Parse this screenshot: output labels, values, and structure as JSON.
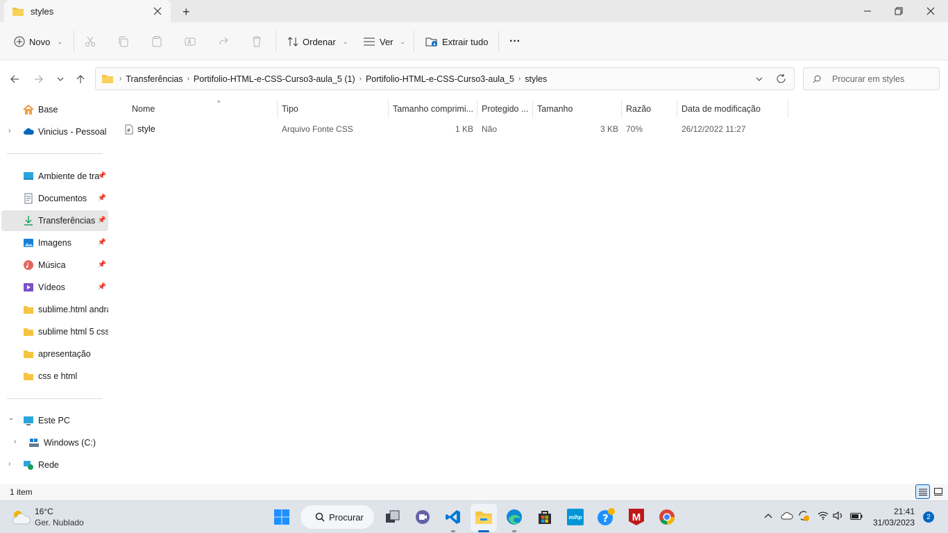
{
  "window": {
    "tab_title": "styles",
    "new_tab_symbol": "+",
    "controls": {
      "minimize_icon": "minimize-icon",
      "maximize_icon": "restore-icon",
      "close_icon": "close-icon"
    }
  },
  "commandbar": {
    "new_label": "Novo",
    "sort_label": "Ordenar",
    "view_label": "Ver",
    "extract_label": "Extrair tudo",
    "more_label": "···"
  },
  "address": {
    "breadcrumbs": [
      "Transferências",
      "Portifolio-HTML-e-CSS-Curso3-aula_5 (1)",
      "Portifolio-HTML-e-CSS-Curso3-aula_5",
      "styles"
    ],
    "separator": "›",
    "search_placeholder": "Procurar em styles"
  },
  "sidebar": {
    "top": [
      {
        "label": "Base",
        "icon": "home-icon"
      },
      {
        "label": "Vinicius - Pessoal",
        "icon": "onedrive-icon",
        "expander": "›"
      }
    ],
    "quick_access": [
      {
        "label": "Ambiente de tra",
        "icon": "desktop-icon",
        "pin": "📌"
      },
      {
        "label": "Documentos",
        "icon": "documents-icon",
        "pin": "📌"
      },
      {
        "label": "Transferências",
        "icon": "downloads-icon",
        "pin": "📌",
        "selected": true
      },
      {
        "label": "Imagens",
        "icon": "pictures-icon",
        "pin": "📌"
      },
      {
        "label": "Música",
        "icon": "music-icon",
        "pin": "📌"
      },
      {
        "label": "Vídeos",
        "icon": "videos-icon",
        "pin": "📌"
      },
      {
        "label": "sublime.html andra",
        "icon": "folder-icon"
      },
      {
        "label": "sublime html 5 css",
        "icon": "folder-icon"
      },
      {
        "label": "apresentação",
        "icon": "folder-icon"
      },
      {
        "label": "css e html",
        "icon": "folder-icon"
      }
    ],
    "this_pc": {
      "label": "Este PC",
      "icon": "pc-icon",
      "expander": "⌄"
    },
    "drive": {
      "label": "Windows (C:)",
      "icon": "drive-icon",
      "expander": "›"
    },
    "network": {
      "label": "Rede",
      "icon": "network-icon",
      "expander": "›"
    }
  },
  "columns": [
    "Nome",
    "Tipo",
    "Tamanho comprimi...",
    "Protegido ...",
    "Tamanho",
    "Razão",
    "Data de modificação"
  ],
  "sort_indicator": "^",
  "files": [
    {
      "name": "style",
      "type": "Arquivo Fonte CSS",
      "compressed_size": "1 KB",
      "protected": "Não",
      "size": "3 KB",
      "ratio": "70%",
      "modified": "26/12/2022 11:27",
      "icon": "css-file-icon"
    }
  ],
  "status": {
    "item_count": "1 item"
  },
  "taskbar": {
    "weather_temp": "16°C",
    "weather_desc": "Ger. Nublado",
    "search_label": "Procurar",
    "time": "21:41",
    "date": "31/03/2023",
    "notification_count": "2",
    "mcafee_glyph": "M",
    "hp_glyph": "m/hp"
  },
  "colors": {
    "accent": "#0067c0",
    "folder": "#f5c542",
    "selection": "#e6e6e6"
  }
}
